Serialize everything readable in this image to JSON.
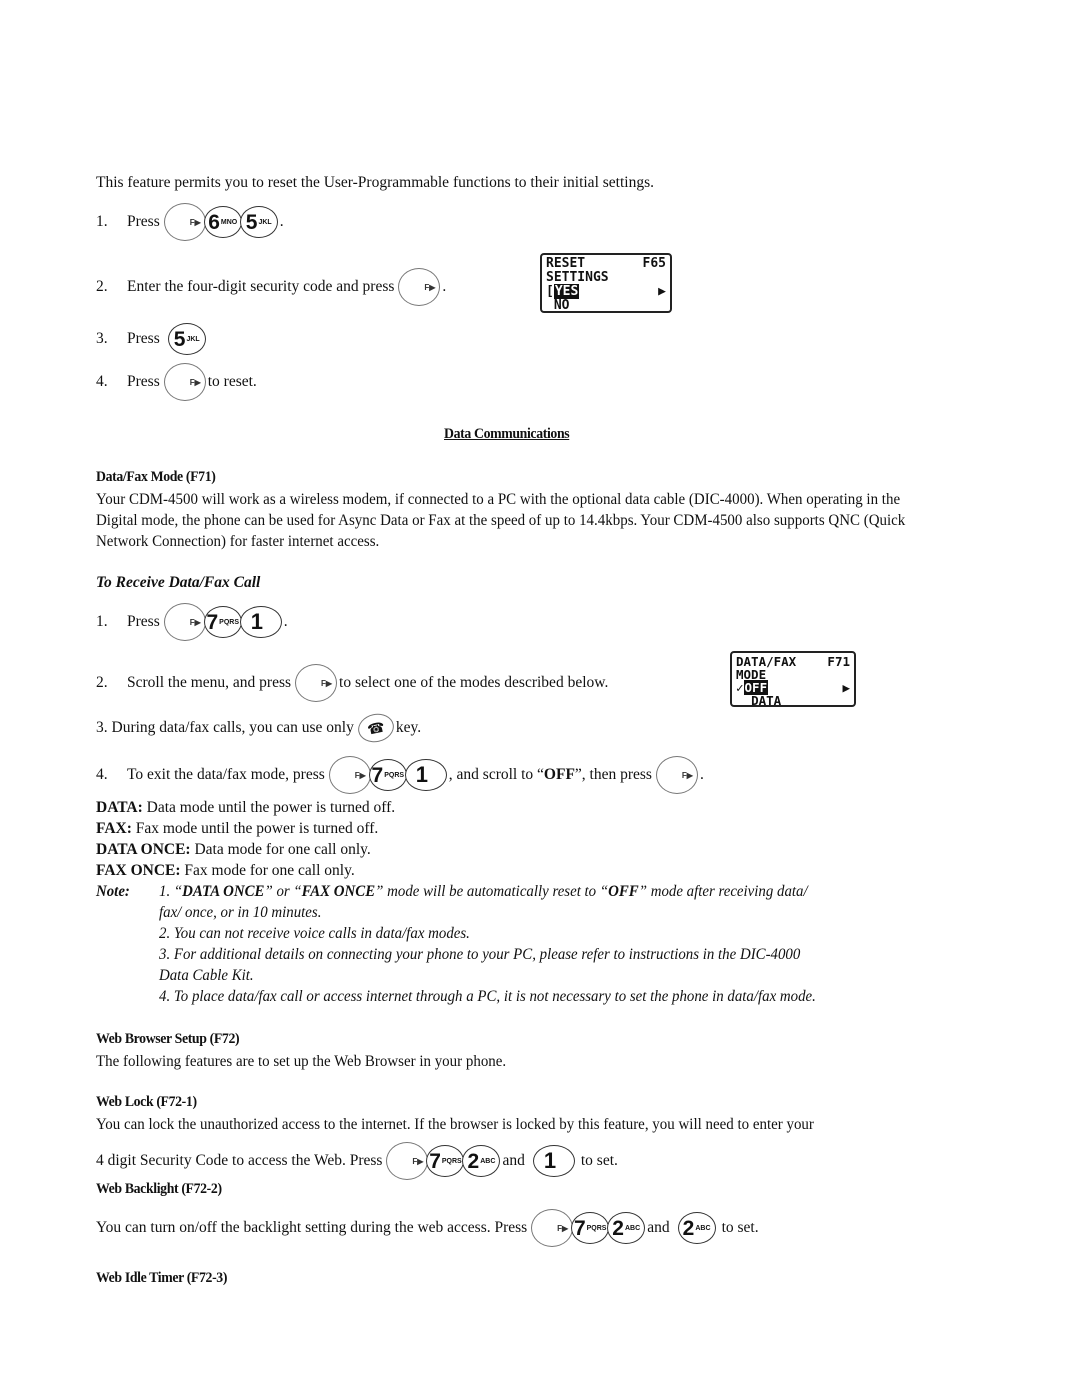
{
  "intro": "This feature permits you to reset the User-Programmable functions to their initial settings.",
  "reset_steps": [
    {
      "num": "1.",
      "pre": "Press",
      "keys": [
        "F",
        "6 MNO",
        "5 JKL"
      ],
      "post": "."
    },
    {
      "num": "2.",
      "pre": "Enter the four-digit security code and press",
      "keys": [
        "F"
      ],
      "post": "."
    },
    {
      "num": "3.",
      "pre": "Press",
      "keys": [
        "5 JKL"
      ],
      "post": ""
    },
    {
      "num": "4.",
      "pre": "Press",
      "keys": [
        "F"
      ],
      "post": "to reset."
    }
  ],
  "keys": {
    "fn": "F▶",
    "six_digit": "6",
    "six_letters": "MNO",
    "five_digit": "5",
    "five_letters": "JKL",
    "seven_digit": "7",
    "seven_letters": "PQRS",
    "two_digit": "2",
    "two_letters": "ABC",
    "one_digit": "1",
    "end_glyph": "☎"
  },
  "lcd_reset": {
    "line1_left": "RESET",
    "line1_right": "F65",
    "line2": "SETTINGS",
    "selected": "YES",
    "line4": "NO",
    "arrow": "▶"
  },
  "section_title": "Data Communications",
  "datafax": {
    "heading": "Data/Fax Mode (F71)",
    "body": "Your CDM-4500 will work as a wireless modem, if connected to a PC with the optional data cable (DIC-4000).  When operating in the Digital mode, the phone can be used for Async Data or Fax at the speed of up to 14.4kbps.  Your CDM-4500 also supports QNC (Quick Network Connection) for faster internet access.",
    "subheading": "To Receive Data/Fax Call",
    "step1_num": "1.",
    "step1_pre": "Press",
    "step1_post": ".",
    "step2_num": "2.",
    "step2_pre": "Scroll the menu, and press",
    "step2_post": "to select one of the modes described below.",
    "step3": "3.  During data/fax calls, you can use only",
    "step3_post": "key.",
    "step4_num": "4.",
    "step4_pre": "To exit the data/fax mode, press",
    "step4_mid": ", and scroll to “",
    "step4_bold": "OFF",
    "step4_mid2": "”, then press",
    "step4_post": "."
  },
  "lcd_datafax": {
    "line1_left": "DATA/FAX",
    "line1_right": "F71",
    "line2": "MODE",
    "check": "✓",
    "selected": "OFF",
    "line4": "DATA",
    "arrow": "▶"
  },
  "modes": [
    {
      "label": "DATA:",
      "desc": " Data mode until the power is turned off."
    },
    {
      "label": "FAX:",
      "desc": " Fax mode until the power is turned off."
    },
    {
      "label": "DATA ONCE:",
      "desc": " Data mode for one call only."
    },
    {
      "label": "FAX ONCE:",
      "desc": " Fax mode for one call only."
    }
  ],
  "note": {
    "label": "Note:",
    "item1_a": "1. “",
    "item1_b1": "DATA ONCE",
    "item1_c": "” or “",
    "item1_b2": "FAX ONCE",
    "item1_d": "” mode will be automatically reset to “",
    "item1_b3": "OFF",
    "item1_e": "” mode after receiving data/",
    "item1_cont": "fax/ once, or in 10 minutes.",
    "item2": "2.  You can not receive voice calls in data/fax modes.",
    "item3": "3.   For additional details on connecting your phone to your PC, please refer to instructions in the DIC-4000",
    "item3_cont": "Data Cable Kit.",
    "item4": "4.  To place data/fax call or access internet through a PC, it is not necessary to set the phone in data/fax mode."
  },
  "web_browser": {
    "heading": "Web Browser Setup (F72)",
    "body": "The following features are to set up the Web Browser in your phone."
  },
  "web_lock": {
    "heading": "Web Lock (F72-1)",
    "body1": "You can lock the unauthorized access to the internet.  If the browser is locked by this feature, you will need to enter your",
    "body2_pre": "4 digit Security Code to access the Web.  Press",
    "and": "and",
    "post": "to set."
  },
  "web_backlight": {
    "heading": "Web Backlight (F72-2)",
    "body_pre": "You can turn on/off the backlight setting during the web access.  Press",
    "and": "and",
    "post": "to set."
  },
  "web_idle": {
    "heading": "Web Idle Timer (F72-3)"
  }
}
